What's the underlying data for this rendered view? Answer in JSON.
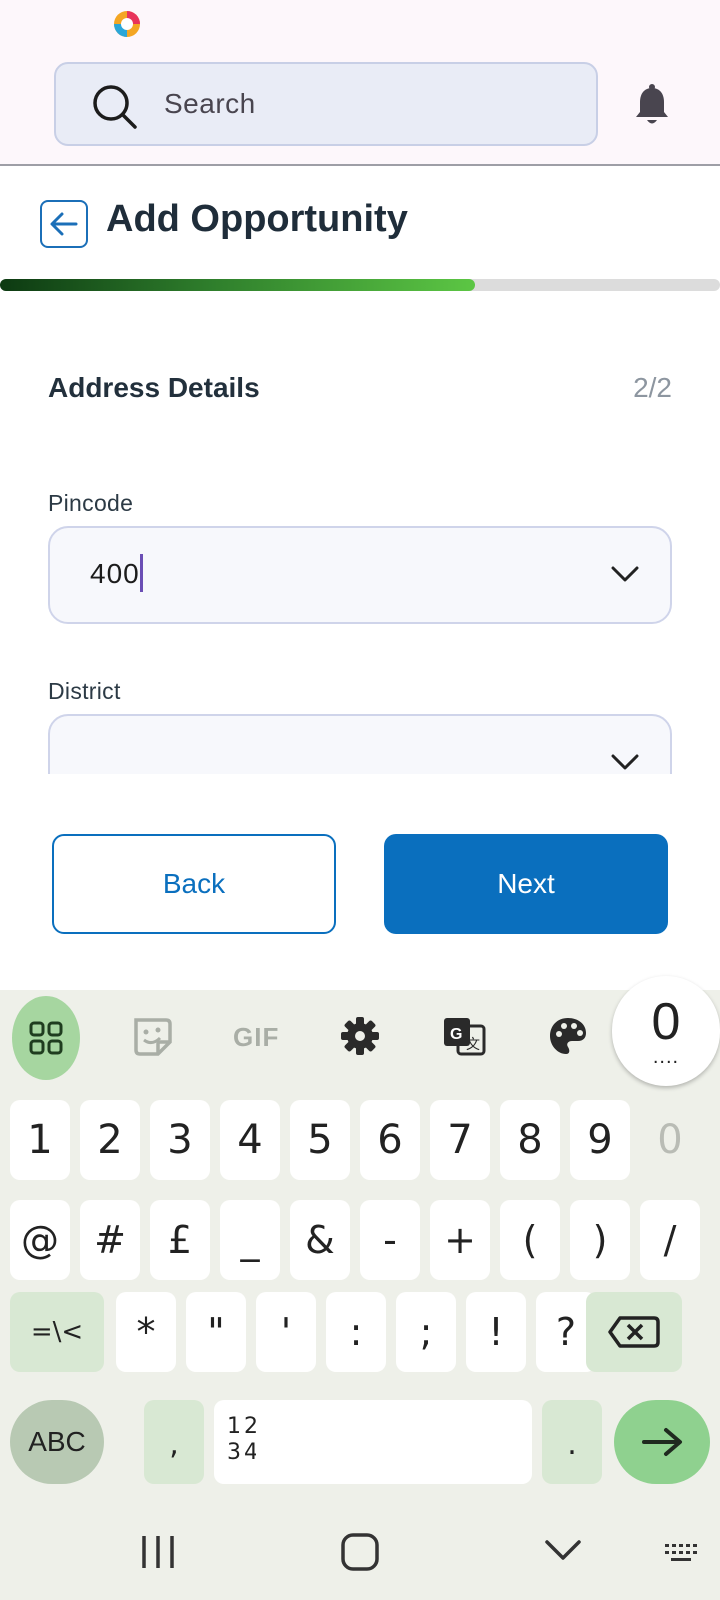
{
  "header": {
    "search_placeholder": "Search"
  },
  "page": {
    "title": "Add Opportunity",
    "progress_fraction": 0.66
  },
  "form": {
    "section_title": "Address Details",
    "step": "2/2",
    "pincode": {
      "label": "Pincode",
      "value": "400"
    },
    "district": {
      "label": "District",
      "value": ""
    }
  },
  "buttons": {
    "back_label": "Back",
    "next_label": "Next"
  },
  "keyboard": {
    "toolbar": [
      "apps-icon",
      "sticker-icon",
      "GIF",
      "settings-icon",
      "translate-icon",
      "palette-icon"
    ],
    "gif_label": "GIF",
    "preview_key": "0",
    "preview_more": "....",
    "row1": [
      "1",
      "2",
      "3",
      "4",
      "5",
      "6",
      "7",
      "8",
      "9",
      "0"
    ],
    "row2": [
      "@",
      "#",
      "£",
      "_",
      "&",
      "-",
      "+",
      "(",
      ")",
      "/"
    ],
    "row3": [
      "=\\<",
      "*",
      "\"",
      "'",
      ":",
      ";",
      "!",
      "?"
    ],
    "abc_label": "ABC",
    "comma": ",",
    "numpad_top": "12",
    "numpad_bottom": "34",
    "period": "."
  },
  "colors": {
    "primary": "#0a6fbe",
    "progress_green": "#5cc644",
    "keyboard_accent": "#a6d6a0"
  }
}
